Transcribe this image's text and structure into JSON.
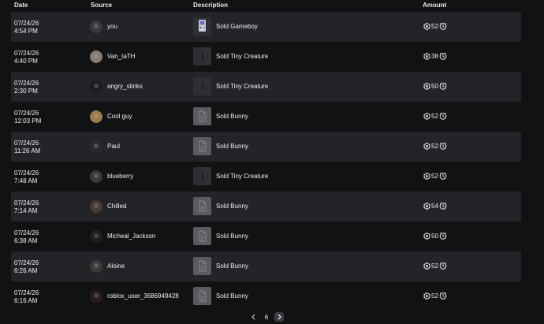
{
  "header": {
    "date": "Date",
    "source": "Source",
    "description": "Description",
    "amount": "Amount"
  },
  "rows": [
    {
      "date": "07/24/26",
      "time": "4:54 PM",
      "source": "you",
      "description": "Sold Gameboy",
      "amount": "52",
      "thumb": "gameboy"
    },
    {
      "date": "07/24/26",
      "time": "4:40 PM",
      "source": "Van_taTH",
      "description": "Sold Tiny Creature",
      "amount": "38",
      "thumb": "creature"
    },
    {
      "date": "07/24/26",
      "time": "2:30 PM",
      "source": "angry_stinks",
      "description": "Sold Tiny Creature",
      "amount": "50",
      "thumb": "creature"
    },
    {
      "date": "07/24/26",
      "time": "12:03 PM",
      "source": "Cool guy",
      "description": "Sold Bunny",
      "amount": "52",
      "thumb": "bunny"
    },
    {
      "date": "07/24/26",
      "time": "11:26 AM",
      "source": "Paul",
      "description": "Sold Bunny",
      "amount": "52",
      "thumb": "bunny"
    },
    {
      "date": "07/24/26",
      "time": "7:48 AM",
      "source": "blueberry",
      "description": "Sold Tiny Creature",
      "amount": "52",
      "thumb": "creature"
    },
    {
      "date": "07/24/26",
      "time": "7:14 AM",
      "source": "Chilled",
      "description": "Sold Bunny",
      "amount": "54",
      "thumb": "bunny"
    },
    {
      "date": "07/24/26",
      "time": "6:38 AM",
      "source": "Micheal_Jackson",
      "description": "Sold Bunny",
      "amount": "50",
      "thumb": "bunny"
    },
    {
      "date": "07/24/26",
      "time": "6:26 AM",
      "source": "Aloine",
      "description": "Sold Bunny",
      "amount": "52",
      "thumb": "bunny"
    },
    {
      "date": "07/24/26",
      "time": "6:16 AM",
      "source": "roblox_user_3686949428",
      "description": "Sold Bunny",
      "amount": "52",
      "thumb": "bunny"
    }
  ],
  "pagination": {
    "current_page": "6"
  },
  "icons": {
    "currency": "robux-icon",
    "pending": "pending-clock-icon",
    "prev": "chevron-left-icon",
    "next": "chevron-right-icon"
  }
}
